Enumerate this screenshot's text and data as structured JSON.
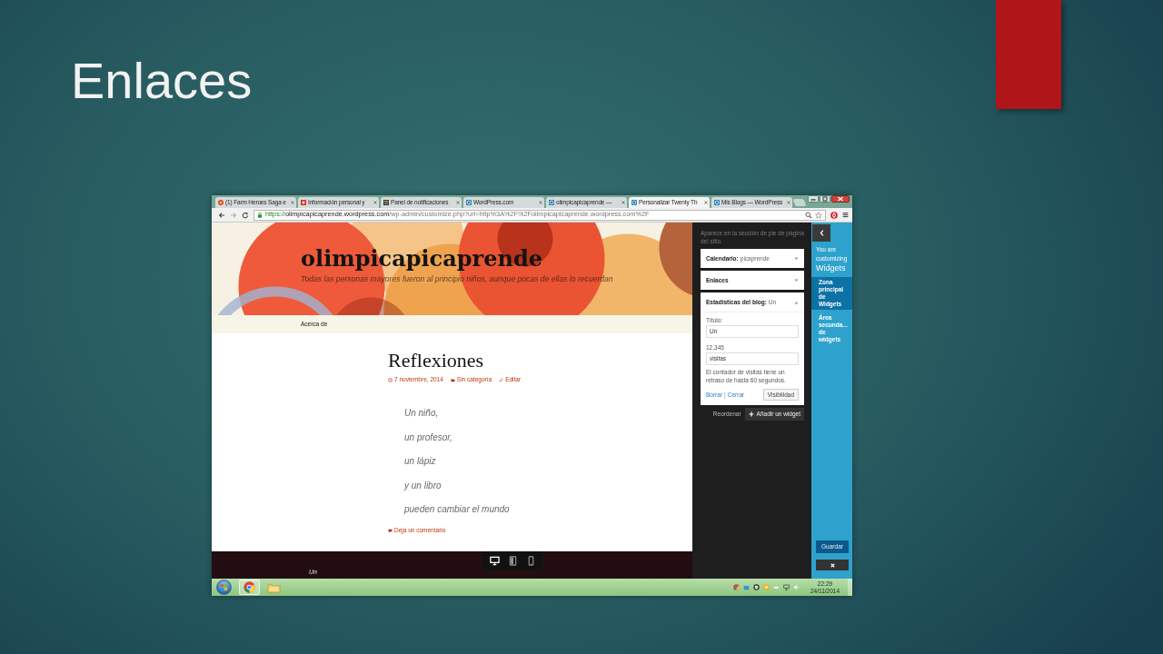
{
  "slide": {
    "title": "Enlaces"
  },
  "browser": {
    "tabs": [
      {
        "label": "(1) Farm Heroes Saga e",
        "selected": false
      },
      {
        "label": "Información personal y",
        "selected": false
      },
      {
        "label": "Panel de notificaciones",
        "selected": false
      },
      {
        "label": "WordPress.com",
        "selected": false
      },
      {
        "label": "olimpicapicaprende —",
        "selected": false
      },
      {
        "label": "Personalizar Twenty Th",
        "selected": true
      },
      {
        "label": "Mis Blogs — WordPress",
        "selected": false
      }
    ],
    "address": {
      "scheme": "https://",
      "host": "olimpicapicaprende.wordpress.com",
      "path": "/wp-admin/customize.php?url=http%3A%2F%2Folimpicapicaprende.wordpress.com%2F"
    }
  },
  "site": {
    "title": "olimpicapicaprende",
    "tagline": "Todas las personas mayores fueron al principio niños, aunque pocas de ellas lo recuerdan",
    "menu": [
      "Acerca de"
    ]
  },
  "post": {
    "title": "Reflexiones",
    "meta": [
      {
        "kind": "date",
        "text": "7 noviembre, 2014"
      },
      {
        "kind": "category",
        "text": "Sin categoría"
      },
      {
        "kind": "edit",
        "text": "Editar"
      }
    ],
    "lines": [
      "Un niño,",
      "un profesor,",
      "un lápiz",
      "y un libro",
      "pueden cambiar el mundo"
    ],
    "comment_link": "Deja un comentario"
  },
  "footer": {
    "text": "Un"
  },
  "device_buttons": [
    {
      "kind": "desktop",
      "selected": true
    },
    {
      "kind": "tablet",
      "selected": false
    },
    {
      "kind": "mobile",
      "selected": false
    }
  ],
  "customizer": {
    "description": "Aparece en la sección de pie de página del sitio.",
    "widgets": [
      {
        "name": "Calendario:",
        "title": "picaprende",
        "expanded": false
      },
      {
        "name": "Enlaces",
        "expanded": false
      },
      {
        "name": "Estadísticas del blog:",
        "title": "Un",
        "expanded": true,
        "fields": [
          {
            "label": "Título:",
            "value": "Un"
          },
          {
            "label": "12,345",
            "value": "visitas"
          }
        ],
        "note": "El contador de visitas tiene un retraso de hasta 60 segundos.",
        "links": [
          "Borrar",
          "Cerrar"
        ],
        "separator": "|",
        "button": "Visibilidad"
      }
    ],
    "reorder": "Reordenar",
    "add_button": "Añadir un widget"
  },
  "nav": {
    "intro": "You are customizing",
    "section": "Widgets",
    "items": [
      {
        "label": "Zona principal de Widgets",
        "selected": true
      },
      {
        "label": "Área secunda... de widgets",
        "selected": false
      }
    ],
    "save": "Guardar"
  },
  "taskbar": {
    "time": "22:29",
    "date": "24/11/2014"
  }
}
